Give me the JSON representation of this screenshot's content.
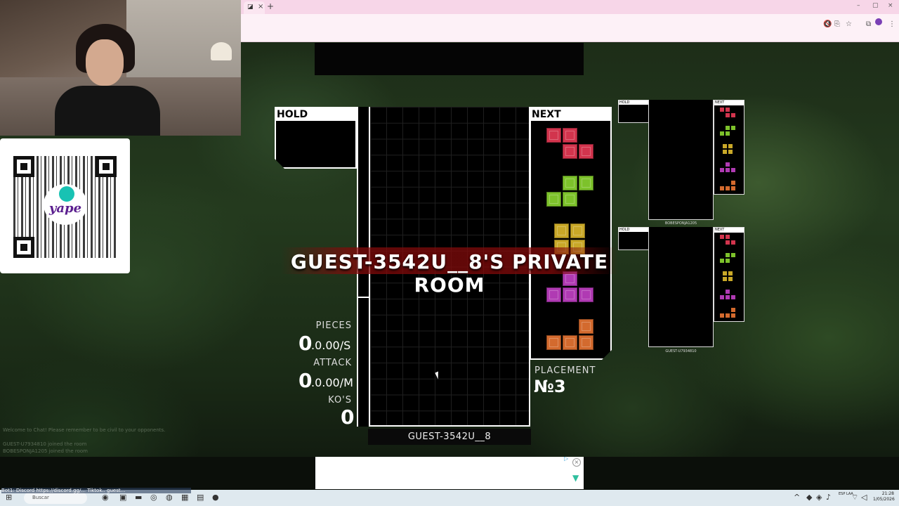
{
  "browser": {
    "tab_icon": "tab-favicon-icon",
    "tab_close": "×",
    "new_tab": "+",
    "window_controls": [
      "–",
      "▢",
      "×"
    ],
    "avatar_letter": ""
  },
  "game": {
    "hold_label": "HOLD",
    "next_label": "NEXT",
    "room_banner": "GUEST-3542U__8'S PRIVATE ROOM",
    "player_name": "GUEST-3542U__8",
    "stats": {
      "pieces_label": "PIECES",
      "pieces_value": "0",
      "pieces_rate": ".0.00/S",
      "attack_label": "ATTACK",
      "attack_value": "0",
      "attack_rate": ".0.00/M",
      "kos_label": "KO'S",
      "kos_value": "0"
    },
    "placement_label": "PLACEMENT",
    "placement_value": "№3",
    "next_queue": [
      "Z",
      "S",
      "O",
      "T",
      "L"
    ],
    "colors": {
      "Z": "#d2344d",
      "S": "#7dc22b",
      "O": "#c9a828",
      "T": "#b03ab3",
      "L": "#d36a2e"
    },
    "opponents": [
      {
        "name": "BOBESPONJA1205",
        "hold_label": "HOLD",
        "next_label": "NEXT",
        "next_queue": [
          "Z",
          "S",
          "O",
          "T",
          "L"
        ]
      },
      {
        "name": "GUEST-U7934810",
        "hold_label": "HOLD",
        "next_label": "NEXT",
        "next_queue": [
          "Z",
          "S",
          "O",
          "T",
          "L"
        ]
      }
    ]
  },
  "stream": {
    "qr_brand": "yape",
    "ticker": "Bot1: Discord https://discord.gg/... Tiktok.. guest...",
    "chat_lines": [
      "Welcome to Chat! Please remember to be civil to your opponents.",
      "GUEST-U7934810 joined the room",
      "BOBESPONJA1205 joined the room"
    ]
  },
  "taskbar": {
    "search_placeholder": "Buscar",
    "lang": "ESP\nLAA",
    "time": "21:28",
    "date": "1/05/2026"
  }
}
